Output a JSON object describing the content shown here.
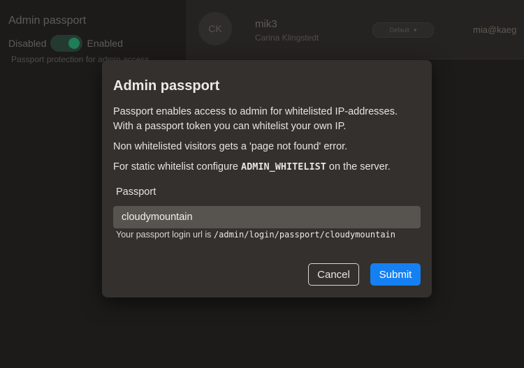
{
  "background": {
    "admin_passport": {
      "title": "Admin passport",
      "disabled_label": "Disabled",
      "enabled_label": "Enabled",
      "description": "Passport protection for admin access"
    },
    "user_card": {
      "initials": "CK",
      "username": "mik3",
      "full_name": "Carina Klingstedt",
      "role_select": "Default",
      "email": "mia@kaeg"
    }
  },
  "modal": {
    "title": "Admin passport",
    "paragraph1_line1": "Passport enables access to admin for whitelisted IP-addresses.",
    "paragraph1_line2": "With a passport token you can whitelist your own IP.",
    "paragraph2": "Non whitelisted visitors gets a 'page not found' error.",
    "paragraph3_prefix": "For static whitelist configure ",
    "paragraph3_code": "ADMIN_WHITELIST",
    "paragraph3_suffix": " on the server.",
    "passport_label": "Passport",
    "passport_value": "cloudymountain",
    "hint_prefix": "Your passport login url is ",
    "hint_url": "/admin/login/passport/cloudymountain",
    "cancel_label": "Cancel",
    "submit_label": "Submit"
  },
  "colors": {
    "accent": "#1580f2",
    "modal_bg": "#33302e",
    "input_bg": "#57534f"
  }
}
